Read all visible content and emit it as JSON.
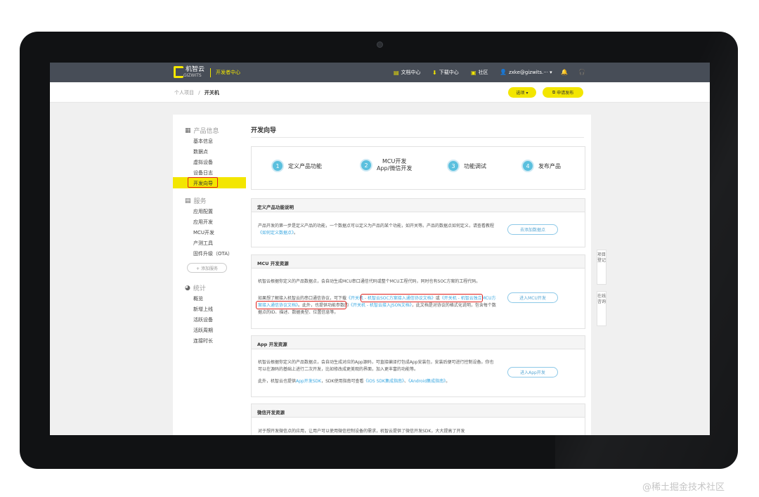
{
  "topnav": {
    "logo_name": "机智云",
    "logo_sub": "GIZWITS",
    "dev_center": "开发者中心",
    "docs": "文档中心",
    "download": "下载中心",
    "community": "社区",
    "user": "zxke@gizwits.··· ▾"
  },
  "subheader": {
    "breadcrumb_parent": "个人项目",
    "breadcrumb_sep": "/",
    "breadcrumb_current": "开关机",
    "options_button": "选项 ▾",
    "publish_button": "申请发布"
  },
  "sidebar": {
    "sections": [
      {
        "label": "产品信息",
        "icon": "grid-icon",
        "items": [
          "基本信息",
          "数据点",
          "虚拟设备",
          "设备日志",
          "开发向导"
        ]
      },
      {
        "label": "服务",
        "icon": "book-icon",
        "items": [
          "应用配置",
          "应用开发",
          "MCU开发",
          "产测工具",
          "固件升级（OTA）"
        ]
      },
      {
        "label": "统计",
        "icon": "pie-icon",
        "items": [
          "概览",
          "新增上线",
          "活跃设备",
          "活跃周期",
          "连接时长"
        ]
      }
    ],
    "active_item": "开发向导",
    "add_service": "+ 添加服务"
  },
  "main": {
    "title": "开发向导",
    "steps": [
      {
        "num": "1",
        "label": "定义产品功能"
      },
      {
        "num": "2",
        "label_line1": "MCU开发",
        "label_line2": "App/微信开发"
      },
      {
        "num": "3",
        "label": "功能调试"
      },
      {
        "num": "4",
        "label": "发布产品"
      }
    ],
    "panel_define": {
      "title": "定义产品功能说明",
      "text": "产品开发的第一步是定义产品的功能，一个数据点可以定义为产品的某个功能，如开关等。产品的数据点如何定义，请查看教程",
      "link": "《如何定义数据点》",
      "text_end": "。",
      "button": "去添加数据点"
    },
    "panel_mcu": {
      "title": "MCU 开发资源",
      "text1": "机智云根据你定义的产品数据点，会自动生成MCU串口通信代码或整个MCU工程代码，同时也有SOC方案的工程代码。",
      "text2a": "如果想了解接入机智云的串口通信协议，可下载",
      "link1": "《开关机 - 机智云SOC方案接入通信协议文档》",
      "text2b": "或",
      "link2": "《开关机 - 机智云独立MCU方案接入通信协议文档》",
      "text2c": "。此外，也提供功能参数的",
      "link3": "《开关机 - 机智云接入JSON文档》",
      "text2d": "，此文档是对协议的格式化说明，包含每个数据点的ID、描述、数据类型、位置信息等。",
      "button": "进入MCU开发"
    },
    "panel_app": {
      "title": "App 开发资源",
      "text1": "机智云根据你定义的产品数据点，会自动生成对应的App源码，可直接编译打包成App安装包，安装后便可进行控制设备。你也可以在源码的基础上进行二次开发，比如修改成更美观的界面，加入更丰富的功能等。",
      "text2a": "此外，机智云也提供",
      "link1": "App开发SDK",
      "text2b": "，SDK使用指南可查看",
      "link2": "《iOS SDK集成指南》",
      "text2c": "、",
      "link3": "《Android集成指南》",
      "text2d": "。",
      "button": "进入App开发"
    },
    "panel_wechat": {
      "title": "微信开发资源",
      "text": "对于想开发微信点的应用，让用户可以使用微信控制设备的需求，机智云提供了微信开发SDK，大大提高了开发"
    }
  },
  "float_tabs": {
    "register": "项目登记",
    "consult": "在线咨询"
  },
  "watermark": "@稀土掘金技术社区",
  "colors": {
    "accent": "#f3e600",
    "nav": "#474d57",
    "link": "#3aa7e0",
    "step": "#5bc0de",
    "highlight": "#e0201b"
  }
}
